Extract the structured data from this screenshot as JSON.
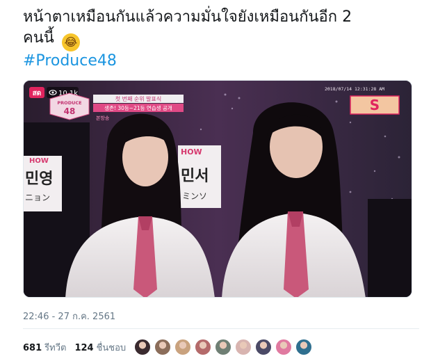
{
  "tweet": {
    "text_line1": "หน้าตาเหมือนกันแล้วความมั่นใจยังเหมือนกันอีก 2",
    "text_line2": "คนนี้",
    "emoji": "😂",
    "hashtag": "#Produce48"
  },
  "media": {
    "live_badge": "สด",
    "view_count": "10.1k",
    "broadcast_date": "2018/07/14 12:31:28 AM",
    "show_logo_line1": "PRODUCE",
    "show_logo_line2": "48",
    "caption_line1": "첫 번째 순위 발표식",
    "caption_line2": "생존! 30등~21등 연습생 공개",
    "caption_tag": "본방송",
    "nameplate_left_top": "HOW",
    "nameplate_left_kr": "민영",
    "nameplate_left_jp": "ニョン",
    "nameplate_right_top": "HOW",
    "nameplate_right_kr": "민서",
    "nameplate_right_jp": "ミンソ",
    "channel_logo": "S"
  },
  "timestamp": "22:46 - 27 ก.ค. 2561",
  "stats": {
    "retweets_count": "681",
    "retweets_label": "รีทวีต",
    "likes_count": "124",
    "likes_label": "ชื่นชอบ"
  },
  "avatars": [
    {
      "color": "#3a2a2f"
    },
    {
      "color": "#8b6d5a"
    },
    {
      "color": "#c9a27e"
    },
    {
      "color": "#b46a6a"
    },
    {
      "color": "#6f7f74"
    },
    {
      "color": "#d8b4b0"
    },
    {
      "color": "#4b4a66"
    },
    {
      "color": "#e07aa0"
    },
    {
      "color": "#2f6f8f"
    }
  ]
}
